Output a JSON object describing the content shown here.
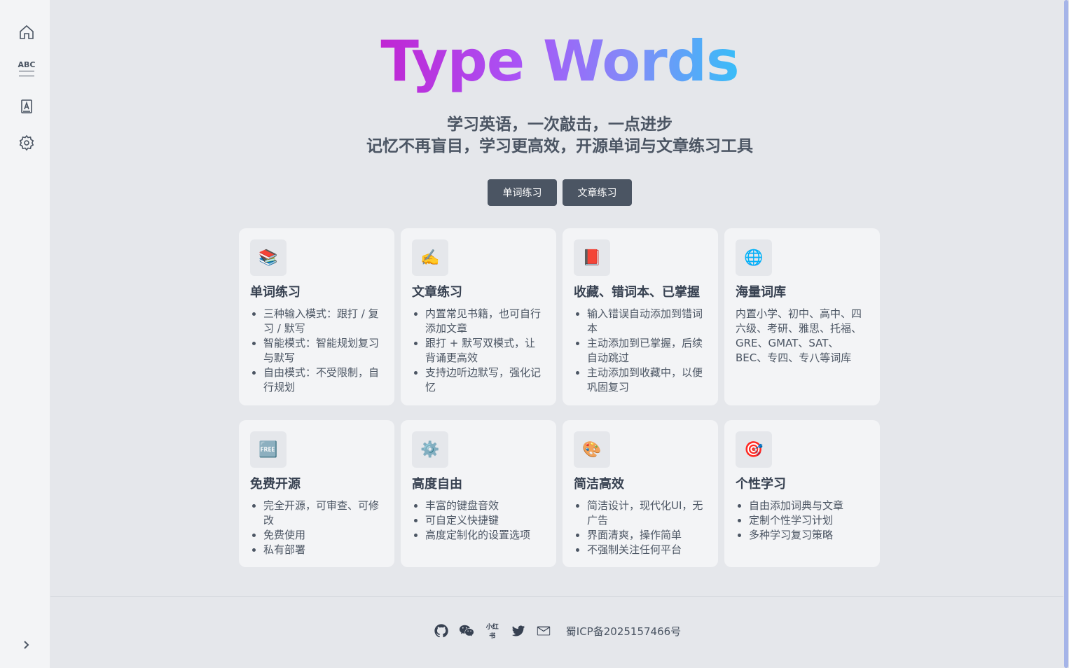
{
  "sidebar": {
    "items": [
      {
        "icon": "home-icon"
      },
      {
        "icon": "abc-words-icon",
        "label": "ABC"
      },
      {
        "icon": "article-book-icon"
      },
      {
        "icon": "gear-icon"
      }
    ],
    "expand_icon": "chevron-right-icon"
  },
  "hero": {
    "title": "Type Words",
    "subtitle_1": "学习英语，一次敲击，一点进步",
    "subtitle_2": "记忆不再盲目，学习更高效，开源单词与文章练习工具",
    "buttons": [
      "单词练习",
      "文章练习"
    ]
  },
  "features": [
    {
      "icon": "📚",
      "title": "单词练习",
      "items": [
        "三种输入模式：跟打 / 复习 / 默写",
        "智能模式：智能规划复习与默写",
        "自由模式：不受限制，自行规划"
      ]
    },
    {
      "icon": "✍️",
      "title": "文章练习",
      "items": [
        "内置常见书籍，也可自行添加文章",
        "跟打 + 默写双模式，让背诵更高效",
        "支持边听边默写，强化记忆"
      ]
    },
    {
      "icon": "📕",
      "title": "收藏、错词本、已掌握",
      "items": [
        "输入错误自动添加到错词本",
        "主动添加到已掌握，后续自动跳过",
        "主动添加到收藏中，以便巩固复习"
      ]
    },
    {
      "icon": "🌐",
      "title": "海量词库",
      "text": "内置小学、初中、高中、四六级、考研、雅思、托福、GRE、GMAT、SAT、BEC、专四、专八等词库"
    },
    {
      "icon": "🆓",
      "title": "免费开源",
      "items": [
        "完全开源，可审查、可修改",
        "免费使用",
        "私有部署"
      ]
    },
    {
      "icon": "⚙️",
      "title": "高度自由",
      "items": [
        "丰富的键盘音效",
        "可自定义快捷键",
        "高度定制化的设置选项"
      ]
    },
    {
      "icon": "🎨",
      "title": "简洁高效",
      "items": [
        "简洁设计，现代化UI，无广告",
        "界面清爽，操作简单",
        "不强制关注任何平台"
      ]
    },
    {
      "icon": "🎯",
      "title": "个性学习",
      "items": [
        "自由添加词典与文章",
        "定制个性学习计划",
        "多种学习复习策略"
      ]
    }
  ],
  "footer": {
    "icons": [
      "github-icon",
      "wechat-icon",
      "xiaohongshu-icon",
      "twitter-icon",
      "mail-icon"
    ],
    "xiaohongshu_label": "小红书",
    "icp": "蜀ICP备2025157466号"
  }
}
